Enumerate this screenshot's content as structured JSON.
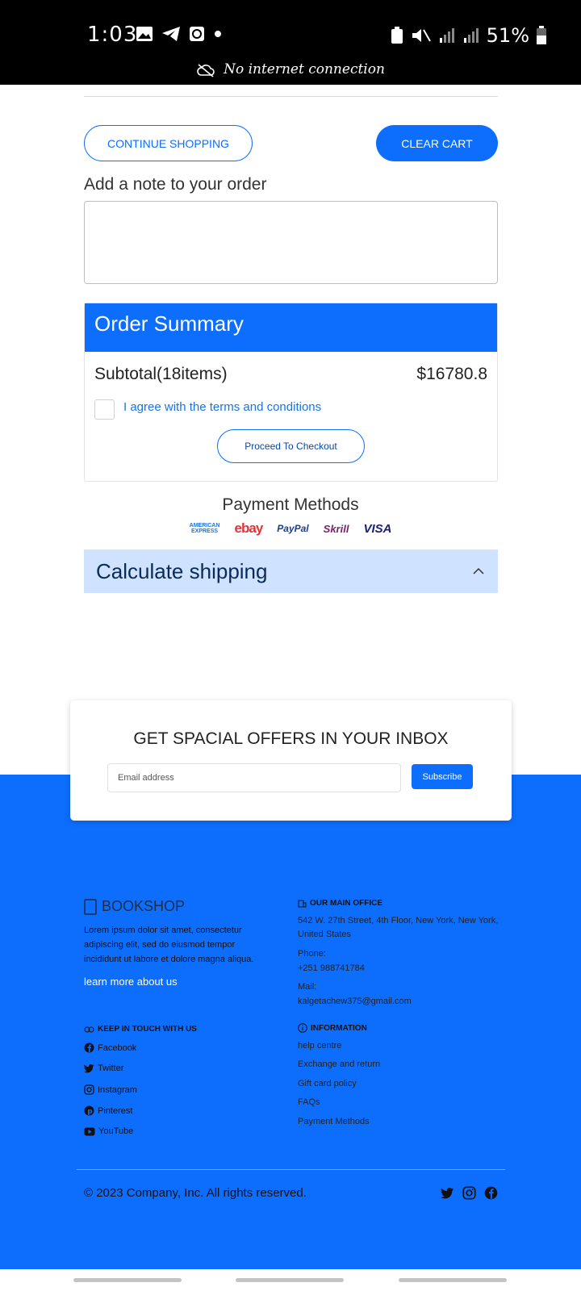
{
  "status_bar": {
    "time": "1:03",
    "battery": "51%",
    "network_message": "No internet connection"
  },
  "cart": {
    "continue_label": "CONTINUE SHOPPING",
    "clear_label": "CLEAR CART",
    "note_label": "Add a note to your order",
    "note_value": ""
  },
  "summary": {
    "title": "Order Summary",
    "subtotal_label": "Subtotal(18items)",
    "subtotal_value": "$16780.8",
    "agree_label": "I agree with the terms and conditions",
    "checkout_label": "Proceed To Checkout"
  },
  "payment": {
    "title": "Payment Methods",
    "logos": [
      "AMERICAN EXPRESS",
      "ebay",
      "PayPal",
      "Skrill",
      "VISA"
    ]
  },
  "shipping": {
    "label": "Calculate shipping"
  },
  "newsletter": {
    "title": "GET SPACIAL OFFERS IN YOUR INBOX",
    "placeholder": "Email address",
    "button": "Subscribe"
  },
  "footer": {
    "brand": "BOOKSHOP",
    "about": "Lorem ipsum dolor sit amet, consectetur adipiscing elit, sed do eiusmod tempor incididunt ut labore et dolore magna aliqua.",
    "learn_more": "learn more about us",
    "office_heading": "OUR MAIN OFFICE",
    "address": "542 W. 27th Street, 4th Floor, New York, New York, United States",
    "phone_label": "Phone:",
    "phone": "+251 988741784",
    "mail_label": "Mail:",
    "mail": "kalgetachew375@gmail.com",
    "touch_heading": "KEEP IN TOUCH WITH US",
    "social": [
      "Facebook",
      "Twitter",
      "Instagram",
      "Pinterest",
      "YouTube"
    ],
    "info_heading": "INFORMATION",
    "info_links": [
      "help centre",
      "Exchange and return",
      "Gift card policy",
      "FAQs",
      "Payment Methods"
    ],
    "copyright": "© 2023 Company, Inc. All rights reserved."
  },
  "colors": {
    "primary": "#0d6efd",
    "shipping_bg": "#cfe2ff",
    "status_bar": "#000000"
  }
}
